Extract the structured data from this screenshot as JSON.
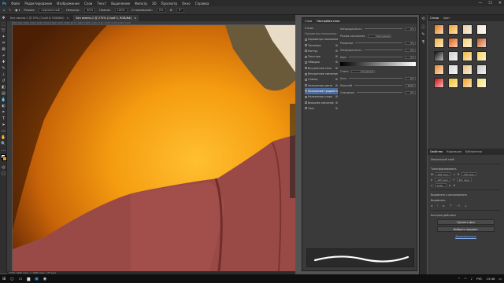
{
  "app": {
    "menu": [
      "Файл",
      "Редактирование",
      "Изображение",
      "Слои",
      "Текст",
      "Выделение",
      "Фильтр",
      "3D",
      "Просмотр",
      "Окно",
      "Справка"
    ],
    "window_controls": [
      "—",
      "☐",
      "✕"
    ]
  },
  "options_bar": {
    "mode_label": "Режим:",
    "mode_value": "нормальный",
    "opacity_label": "Непрозр.:",
    "opacity_value": "60%",
    "pressure_label": "Нажим:",
    "pressure_value": "100%",
    "smoothing_label": "Сглаживание:",
    "smoothing_value": "0%",
    "angle_value": "0°"
  },
  "tabs": [
    {
      "label": "Без имени-1 @ 33% (Слой 8, RGB/8#)"
    },
    {
      "label": "Без имени-1 @ 275% (Слой 5, RGB/8#)"
    }
  ],
  "ruler": {
    "ticks": "980    990    1000    1010    1020    1030    1040    1050    1060    1070    1080    1090    1100    1110    1120    1130    1140    1150"
  },
  "status": {
    "text": "275%    1920 пикс. x 1080 пикс. (72 ppi)"
  },
  "layer_style": {
    "title_tab1": "Слои",
    "title_tab2": "Настройки слоя",
    "style_btn": "Стили",
    "section": "Параметры наложения",
    "items": [
      {
        "label": "Параметры наложения",
        "checked": false,
        "sel": false
      },
      {
        "label": "Тиснение",
        "checked": false,
        "sel": false
      },
      {
        "label": "Контур",
        "checked": false,
        "sel": false
      },
      {
        "label": "Текстура",
        "checked": false,
        "sel": false
      },
      {
        "label": "Обводка",
        "checked": false,
        "sel": false
      },
      {
        "label": "Внутренняя тень",
        "checked": false,
        "sel": false
      },
      {
        "label": "Внутреннее свечение",
        "checked": false,
        "sel": false
      },
      {
        "label": "Глянец",
        "checked": false,
        "sel": false
      },
      {
        "label": "Наложение цвета",
        "checked": false,
        "sel": false
      },
      {
        "label": "Наложение градиента",
        "checked": true,
        "sel": true
      },
      {
        "label": "Наложение узора",
        "checked": false,
        "sel": false
      },
      {
        "label": "Внешнее свечение",
        "checked": false,
        "sel": false
      },
      {
        "label": "Тень",
        "checked": false,
        "sel": false
      }
    ],
    "rows": [
      {
        "label": "Непрозрачность",
        "val": "0%"
      },
      {
        "label": "Режим наложения:",
        "val": "Умножение"
      },
      {
        "label": "Размытие",
        "val": "0%"
      },
      {
        "label": "Непрозрачность",
        "val": "0%"
      },
      {
        "label": "Шум",
        "val": "0%"
      },
      {
        "label": "Стиль:",
        "val": "Линейный"
      },
      {
        "label": "Угол",
        "val": "90°"
      },
      {
        "label": "Масштаб",
        "val": "100%"
      },
      {
        "label": "Смещение",
        "val": "0%"
      }
    ]
  },
  "right_panel": {
    "tabs": [
      "Стили",
      "Цвет"
    ],
    "swatches": [
      "#e07a15",
      "#f4a020",
      "#e9c9a0",
      "#f5e6d6",
      "#f0b040",
      "#e25a10",
      "#f7d070",
      "#c85a20",
      "#111111",
      "#d0d0d0",
      "#f2b33a",
      "#f7d45a",
      "#e88a30",
      "#d8d8d8",
      "#e7c07a",
      "#c8c8c8",
      "#d21010",
      "#f4c020",
      "#f3a020",
      "#f7e070"
    ],
    "prop_tabs": [
      "Свойства",
      "Коррекция",
      "Библиотеки"
    ],
    "pixel_layer": "Пиксельный слой",
    "transform_label": "Трансформировать",
    "w_label": "Ш",
    "w_val": "108 пикс.",
    "h_label": "В",
    "h_val": "758 пикс.",
    "x_label": "X",
    "x_val": "-195 пикс.",
    "y_label": "Y",
    "y_val": "407 пикс.",
    "angle_val": "0,00°",
    "align_label": "Выровнять и распределить",
    "align_sub": "Выровнять:",
    "quick_label": "Быстрые действия",
    "btn1": "Удалить фон",
    "btn2": "Выбрать предмет",
    "link": "Дополнительно"
  },
  "taskbar": {
    "time": "13:46",
    "lang": "РУС"
  }
}
